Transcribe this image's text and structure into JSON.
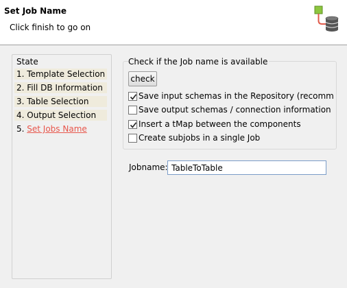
{
  "header": {
    "title": "Set Job Name",
    "subtitle": "Click finish to go on",
    "icon": "job-database-icon"
  },
  "state": {
    "label": "State",
    "items": [
      {
        "number": "1.",
        "label": "Template Selection",
        "active": false
      },
      {
        "number": "2.",
        "label": "Fill DB Information",
        "active": false
      },
      {
        "number": "3.",
        "label": "Table Selection",
        "active": false
      },
      {
        "number": "4.",
        "label": "Output Selection",
        "active": false
      },
      {
        "number": "5.",
        "label": "Set Jobs Name",
        "active": true
      }
    ]
  },
  "check_group": {
    "label": "Check if the Job name is available",
    "button_label": "check",
    "options": [
      {
        "label": "Save input schemas in the Repository (recommanded",
        "checked": true
      },
      {
        "label": "Save output schemas / connection information in the",
        "checked": false
      },
      {
        "label": "Insert a tMap between the components",
        "checked": true
      },
      {
        "label": "Create subjobs in a single Job",
        "checked": false
      }
    ]
  },
  "jobname": {
    "label": "Jobname:",
    "value": "TableToTable"
  },
  "colors": {
    "active_step": "#e8554a",
    "step_background": "#efebdc",
    "icon_green": "#8dc63f",
    "icon_red": "#e05a4a",
    "icon_db": "#555555"
  }
}
